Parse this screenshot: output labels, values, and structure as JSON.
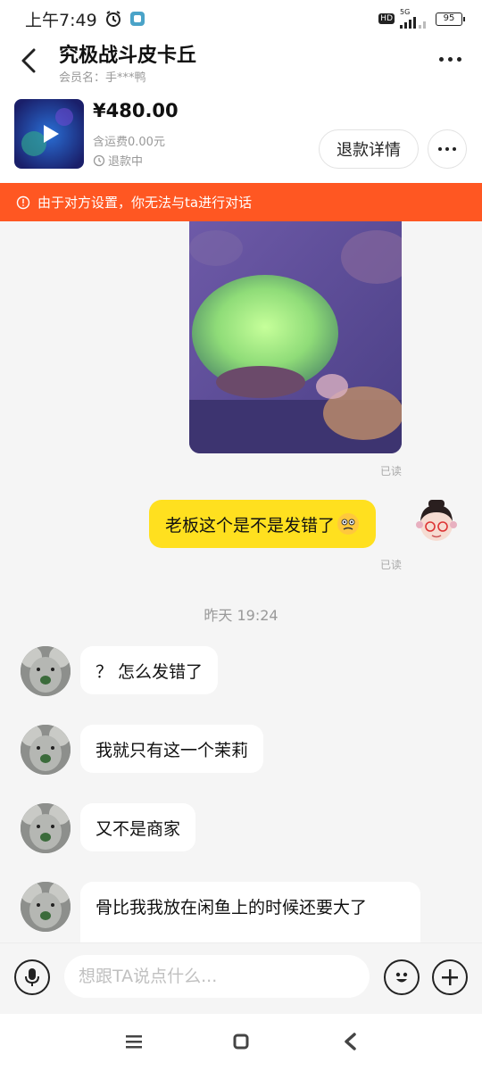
{
  "status_bar": {
    "time": "上午7:49",
    "network_label": "5G",
    "hd_label": "HD",
    "battery_level": "95"
  },
  "header": {
    "title": "究极战斗皮卡丘",
    "member_label": "会员名：手***鸭"
  },
  "order": {
    "price": "¥480.00",
    "shipping": "含运费0.00元",
    "status": "退款中",
    "refund_button": "退款详情"
  },
  "notice": {
    "text": "由于对方设置，你无法与ta进行对话",
    "color": "#ff5722"
  },
  "chat": {
    "read_label_1": "已读",
    "sent_message": "老板这个是不是发错了",
    "read_label_2": "已读",
    "timestamp": "昨天 19:24",
    "received": [
      "？ 怎么发错了",
      "我就只有这一个茉莉",
      "又不是商家",
      "骨比我我放在闲鱼上的时候还要大了"
    ]
  },
  "input": {
    "placeholder": "想跟TA说点什么..."
  },
  "colors": {
    "sent_bubble": "#ffe01f",
    "received_bubble": "#ffffff",
    "background": "#f5f5f5"
  }
}
